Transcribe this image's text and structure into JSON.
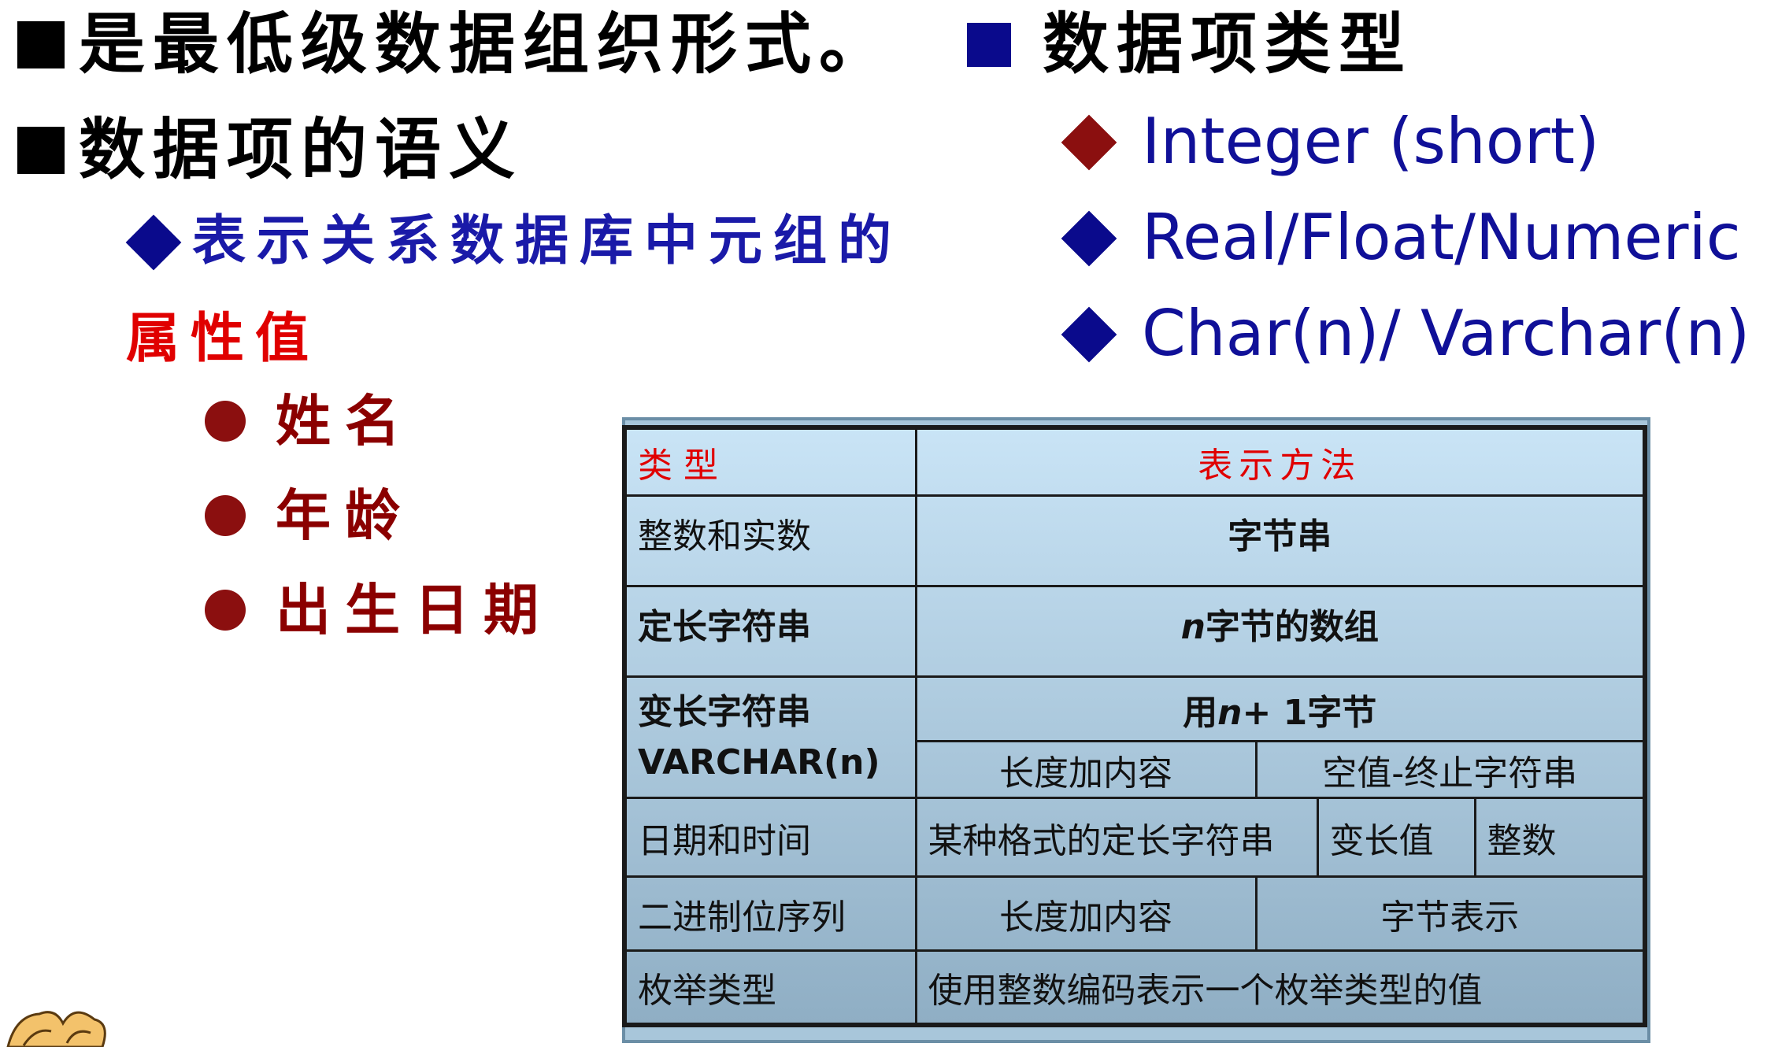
{
  "left": {
    "line1": "是最低级数据组织形式。",
    "line2": "数据项的语义",
    "subline_part1": "表示关系数据库中元组的",
    "subline_part2": "属性值",
    "bullets": [
      "姓名",
      "年龄",
      "出生日期"
    ]
  },
  "right": {
    "title": "数据项类型",
    "types": [
      "Integer (short)",
      "Real/Float/Numeric",
      "Char(n)/ Varchar(n)"
    ]
  },
  "table": {
    "header": {
      "col1": "类 型",
      "col2": "表示方法"
    },
    "rows": {
      "int_real": {
        "type": "整数和实数",
        "rep": "字节串"
      },
      "fixed": {
        "type": "定长字符串",
        "rep_var": "n",
        "rep_rest": "字节的数组"
      },
      "varchar": {
        "type_line1": "变长字符串",
        "type_line2": "VARCHAR(n)",
        "rep_prefix": "用",
        "rep_var": "n",
        "rep_suffix": "+ 1字节",
        "option1": "长度加内容",
        "option2": "空值-终止字符串"
      },
      "datetime": {
        "type": "日期和时间",
        "opt1": "某种格式的定长字符串",
        "opt2": "变长值",
        "opt3": "整数"
      },
      "bits": {
        "type": "二进制位序列",
        "opt1": "长度加内容",
        "opt2": "字节表示"
      },
      "enum": {
        "type": "枚举类型",
        "rep": "使用整数编码表示一个枚举类型的值"
      }
    }
  },
  "colors": {
    "heading": "#000000",
    "blue_square": "#0a0a8c",
    "sub_blue": "#1a1aa8",
    "red": "#e00000",
    "dark_red": "#8b0000",
    "type_blue": "#101098"
  }
}
